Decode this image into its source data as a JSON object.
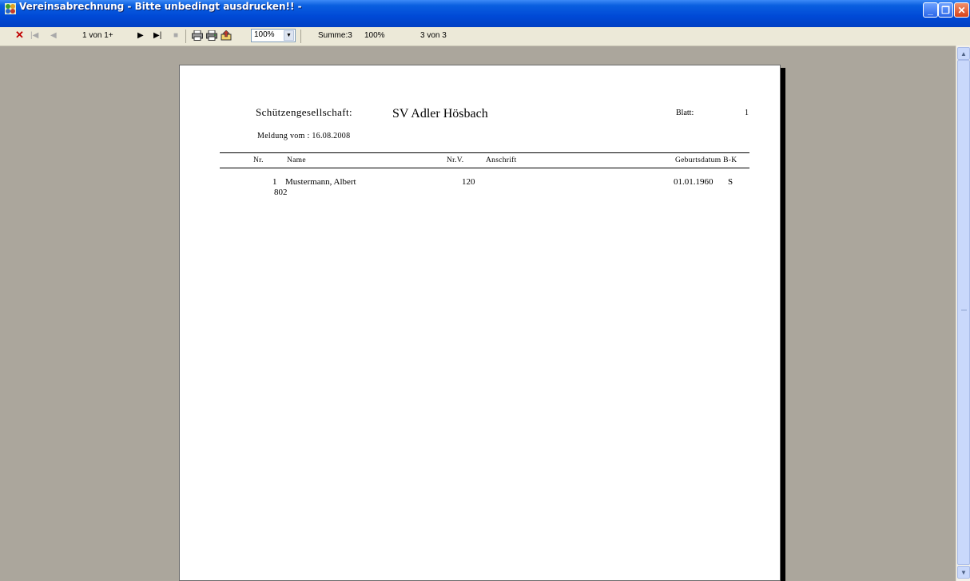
{
  "window": {
    "title": "Vereinsabrechnung - Bitte unbedingt ausdrucken!! -",
    "app_icon": "report-app-icon",
    "controls": {
      "minimize": "_",
      "maximize": "❐",
      "close": "✕"
    }
  },
  "toolbar": {
    "close_glyph": "✕",
    "first_glyph": "|◀",
    "prev_glyph": "◀",
    "page_indicator": "1 von 1+",
    "next_glyph": "▶",
    "last_glyph": "▶|",
    "stop_glyph": "■",
    "print_icon": "printer-icon",
    "print_setup_icon": "printer-setup-icon",
    "export_icon": "export-icon",
    "zoom_value": "100%",
    "summe": "Summe:3",
    "percent": "100%",
    "record_count": "3 von 3"
  },
  "report": {
    "label_club_type": "Schützengesellschaft:",
    "club_name": "SV Adler Hösbach",
    "blatt_label": "Blatt:",
    "blatt_value": "1",
    "meldung": "Meldung vom : 16.08.2008",
    "columns": {
      "nr": "Nr.",
      "name": "Name",
      "nrv": "Nr.V.",
      "anschrift": "Anschrift",
      "geburtsdatum_bk": "Geburtsdatum B-K"
    },
    "rows": [
      {
        "nr": "1",
        "name": "Mustermann, Albert",
        "nrv": "120",
        "anschrift": "",
        "geburtsdatum": "01.01.1960",
        "bk": "S",
        "line2": "802"
      }
    ]
  },
  "colors": {
    "titlebar": "#0049d6",
    "toolbar": "#ece9d8",
    "workspace": "#aba69c",
    "page": "#ffffff"
  }
}
